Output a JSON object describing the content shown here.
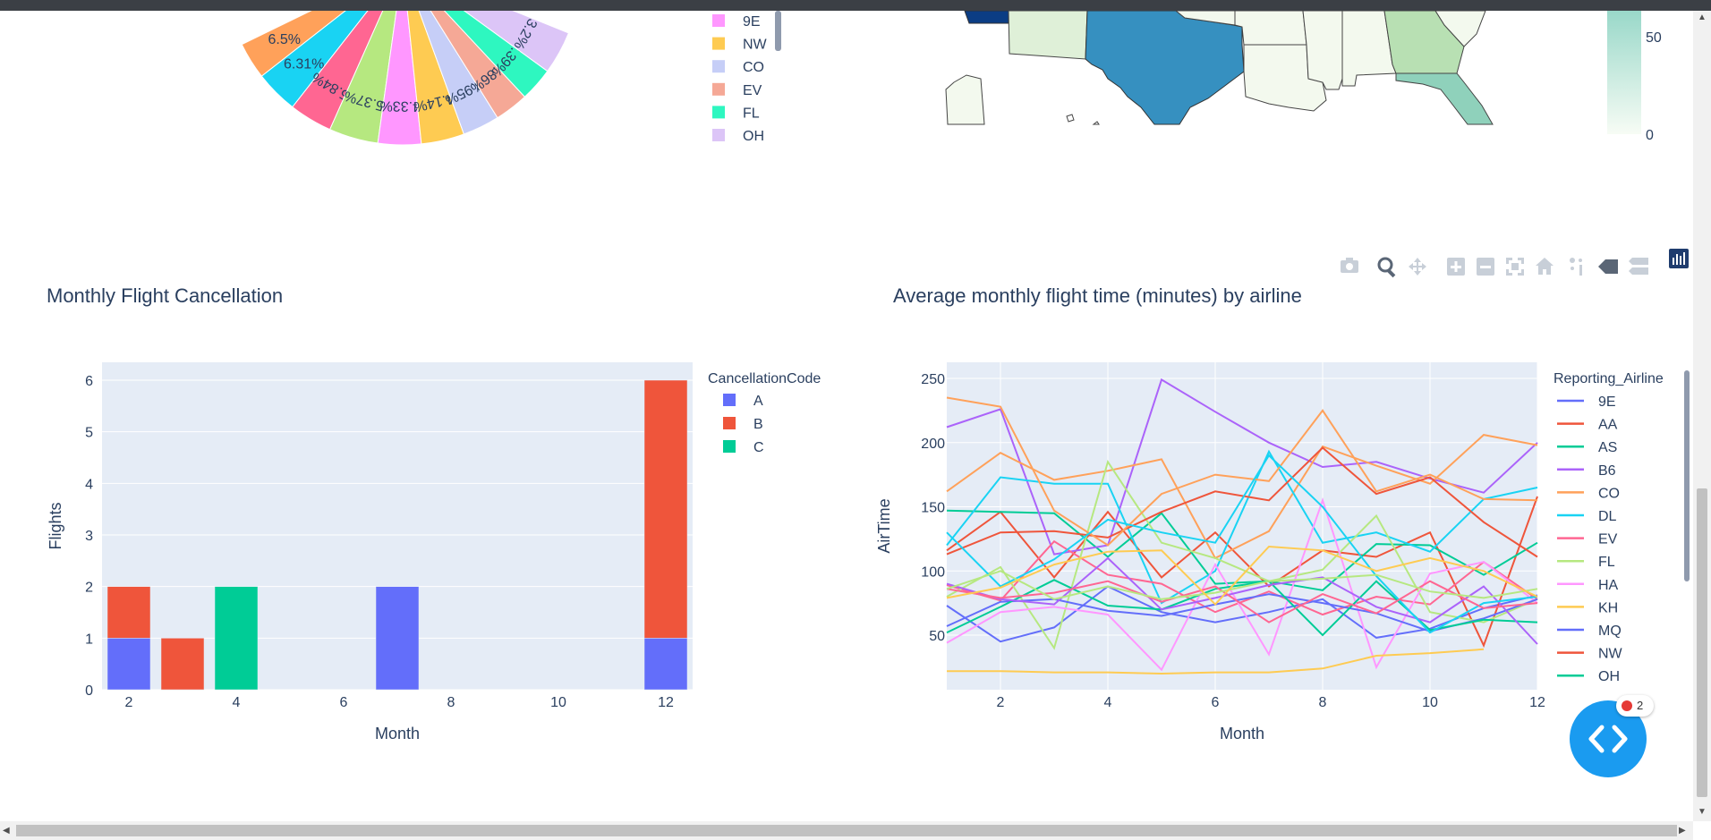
{
  "colors": {
    "plot_bg": "#e5ecf6",
    "text": "#2a3f5f",
    "A": "#636efa",
    "B": "#ef553b",
    "C": "#00cc96",
    "fab": "#1a9bf0"
  },
  "pie": {
    "labels": [
      "6.5%",
      "6.31%",
      "5.84%",
      "5.37%",
      "4.33%",
      "4.14%",
      "3.95%",
      "3.86%",
      "3.39%",
      "3.2%"
    ],
    "legend": [
      {
        "name": "9E",
        "color": "#ff97ff"
      },
      {
        "name": "NW",
        "color": "#fecb52"
      },
      {
        "name": "CO",
        "color": "#c6cef7"
      },
      {
        "name": "EV",
        "color": "#f5a896"
      },
      {
        "name": "FL",
        "color": "#2ef7c0"
      },
      {
        "name": "OH",
        "color": "#dcc5f7"
      }
    ]
  },
  "map": {
    "colorbar_ticks": [
      "50",
      "0"
    ]
  },
  "modebar": {
    "icons": [
      "camera-icon",
      "zoom-icon",
      "pan-icon",
      "zoom-in-icon",
      "zoom-out-icon",
      "autoscale-icon",
      "reset-axes-icon",
      "spike-lines-icon",
      "hover-closest-icon",
      "hover-compare-icon",
      "plotly-logo-icon"
    ]
  },
  "bar_chart": {
    "title": "Monthly Flight Cancellation",
    "legend_title": "CancellationCode",
    "xlabel": "Month",
    "ylabel": "Flights",
    "x_ticks": [
      "2",
      "4",
      "6",
      "8",
      "10",
      "12"
    ],
    "y_ticks": [
      "0",
      "1",
      "2",
      "3",
      "4",
      "5",
      "6"
    ]
  },
  "line_chart": {
    "title": "Average monthly flight time (minutes) by airline",
    "legend_title": "Reporting_Airline",
    "xlabel": "Month",
    "ylabel": "AirTime",
    "x_ticks": [
      "2",
      "4",
      "6",
      "8",
      "10",
      "12"
    ],
    "y_ticks": [
      "50",
      "100",
      "150",
      "200",
      "250"
    ]
  },
  "fab": {
    "label": "<>",
    "badge_count": "2"
  },
  "chart_data": [
    {
      "type": "bar",
      "title": "Monthly Flight Cancellation",
      "xlabel": "Month",
      "ylabel": "Flights",
      "xlim": [
        1.5,
        12.5
      ],
      "ylim": [
        0,
        6.3
      ],
      "series": [
        {
          "name": "A",
          "color": "#636efa",
          "points": [
            {
              "x": 2,
              "y": 1
            },
            {
              "x": 7,
              "y": 2
            },
            {
              "x": 12,
              "y": 1
            }
          ]
        },
        {
          "name": "B",
          "color": "#ef553b",
          "points": [
            {
              "x": 2,
              "y": 1
            },
            {
              "x": 3,
              "y": 1
            },
            {
              "x": 12,
              "y": 5
            }
          ]
        },
        {
          "name": "C",
          "color": "#00cc96",
          "points": [
            {
              "x": 4,
              "y": 2
            }
          ]
        }
      ]
    },
    {
      "type": "line",
      "title": "Average monthly flight time (minutes) by airline",
      "xlabel": "Month",
      "ylabel": "AirTime",
      "xlim": [
        1,
        12
      ],
      "ylim": [
        10,
        265
      ],
      "x": [
        1,
        2,
        3,
        4,
        5,
        6,
        7,
        8,
        9,
        10,
        11,
        12
      ],
      "series": [
        {
          "name": "9E",
          "color": "#636efa",
          "values": [
            73,
            45,
            56,
            88,
            68,
            60,
            68,
            78,
            48,
            55,
            71,
            81
          ]
        },
        {
          "name": "AA",
          "color": "#ef553b",
          "values": [
            116,
            146,
            95,
            146,
            95,
            130,
            88,
            116,
            111,
            130,
            42,
            158
          ]
        },
        {
          "name": "AS",
          "color": "#00cc96",
          "values": [
            147,
            146,
            145,
            111,
            145,
            90,
            92,
            85,
            121,
            120,
            97,
            122
          ]
        },
        {
          "name": "B6",
          "color": "#ab63fa",
          "values": [
            212,
            226,
            113,
            120,
            249,
            224,
            200,
            181,
            185,
            172,
            161,
            200
          ]
        },
        {
          "name": "CO",
          "color": "#ffa15a",
          "values": [
            162,
            192,
            171,
            178,
            187,
            110,
            131,
            197,
            182,
            168,
            206,
            198
          ]
        },
        {
          "name": "DL",
          "color": "#19d3f3",
          "values": [
            120,
            173,
            168,
            168,
            75,
            100,
            193,
            122,
            130,
            115,
            156,
            165
          ]
        },
        {
          "name": "EV",
          "color": "#ff6692",
          "values": [
            89,
            77,
            123,
            97,
            90,
            68,
            84,
            66,
            80,
            74,
            107,
            78
          ]
        },
        {
          "name": "FL",
          "color": "#b6e880",
          "values": [
            80,
            103,
            40,
            185,
            122,
            110,
            92,
            101,
            143,
            68,
            60,
            78
          ]
        },
        {
          "name": "HA",
          "color": "#ff97ff",
          "values": [
            44,
            68,
            72,
            66,
            23,
            105,
            35,
            155,
            25,
            98,
            107,
            75
          ]
        },
        {
          "name": "KH",
          "color": "#fecb52",
          "values": [
            22,
            22,
            21,
            21,
            20,
            21,
            21,
            24,
            34,
            36,
            39,
            null
          ]
        },
        {
          "name": "MQ",
          "color": "#636efa",
          "values": [
            57,
            76,
            78,
            69,
            65,
            74,
            82,
            75,
            67,
            53,
            63,
            78
          ]
        },
        {
          "name": "NW",
          "color": "#ef553b",
          "values": [
            113,
            130,
            131,
            126,
            146,
            162,
            155,
            196,
            160,
            173,
            138,
            111
          ]
        },
        {
          "name": "OH",
          "color": "#00cc96",
          "values": [
            52,
            72,
            93,
            73,
            70,
            86,
            92,
            50,
            92,
            54,
            62,
            60
          ]
        },
        {
          "name": "",
          "color": "#ab63fa",
          "values": [
            90,
            78,
            74,
            110,
            70,
            79,
            89,
            95,
            72,
            60,
            88,
            43
          ]
        },
        {
          "name": "",
          "color": "#ffa15a",
          "values": [
            235,
            228,
            147,
            120,
            160,
            175,
            170,
            225,
            162,
            175,
            156,
            155
          ]
        },
        {
          "name": "",
          "color": "#19d3f3",
          "values": [
            130,
            88,
            109,
            140,
            130,
            122,
            190,
            150,
            96,
            52,
            75,
            80
          ]
        },
        {
          "name": "",
          "color": "#ff6692",
          "values": [
            86,
            79,
            83,
            92,
            76,
            88,
            60,
            82,
            67,
            92,
            71,
            75
          ]
        },
        {
          "name": "",
          "color": "#b6e880",
          "values": [
            86,
            100,
            78,
            88,
            78,
            83,
            92,
            94,
            97,
            84,
            79,
            86
          ]
        },
        {
          "name": "",
          "color": "#fecb52",
          "values": [
            79,
            87,
            105,
            115,
            116,
            74,
            119,
            116,
            100,
            110,
            100,
            80
          ]
        }
      ]
    }
  ]
}
